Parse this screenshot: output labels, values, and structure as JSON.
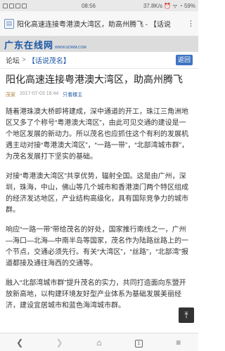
{
  "status_bar": {
    "time": "08:56",
    "right": "37.8K/s ⏰ ᯤ ◔ 59%"
  },
  "browser": {
    "title": "阳化高速连接粤港澳大湾区，助高州腾飞 - 【话说",
    "menu": "⋮",
    "page_icon": "▤"
  },
  "site": {
    "logo": "广东在线网",
    "url": "WWW.GDWM.COM"
  },
  "breadcrumb": {
    "home": "论坛",
    "sep": ">",
    "current": "【话说茂名】",
    "back_label": "返回"
  },
  "article": {
    "title": "阳化高速连接粤港澳大湾区，助高州腾飞",
    "author": "茂家",
    "date": "2017-07-03 16:44",
    "report": "只看楼主",
    "paragraphs": [
      "随着港珠澳大桥即将建成，深中通道的开工，珠江三角洲地区又多了个称号“粤港澳大湾区”，由此可见交通的建设是一个地区发展的新动力。所以茂名也应抓住这个有利的发展机遇主动对接“粤港澳大湾区”，“一路一带”，“北部湾城市群”，为茂名发展打下坚实的基础。",
      "对接“粤港澳大湾区”共享优势，辐射全国。这是由广州，深圳，珠海，中山，佛山等几个城市和香港澳门两个特区组成的经济发达地区，产业结构高级化，具有国际竞争力的城市群。",
      "响应“一路一带”带给茂名的好处，国家推行南线之一，广州—海口—北海—中南半岛等国家，茂名作为陆路丝路上的一个节点，交通必须先行。有关“大湾区”，“丝路”，“北部湾”报道都接及通往海西的交通等。",
      "融入“北部湾城市群”提升茂名的实力，共同打造面向东盟开放新高地，以构建环境友好型产业体系为基础发展美丽经济，建设宜居城市和蓝色海湾城市群。"
    ]
  },
  "toolbar": {
    "back": "❮",
    "forward": "❯",
    "home": "⌂",
    "tabs": "1",
    "menu": "≡"
  },
  "scroll_top": "⤒"
}
